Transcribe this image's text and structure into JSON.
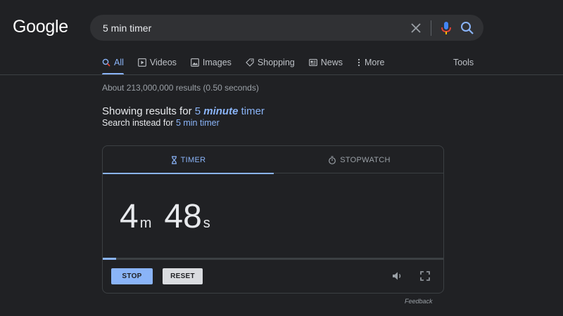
{
  "logo": "Google",
  "search": {
    "query": "5 min timer"
  },
  "tabs": [
    {
      "label": "All",
      "icon": "search-icon"
    },
    {
      "label": "Videos",
      "icon": "play-icon"
    },
    {
      "label": "Images",
      "icon": "image-icon"
    },
    {
      "label": "Shopping",
      "icon": "tag-icon"
    },
    {
      "label": "News",
      "icon": "news-icon"
    },
    {
      "label": "More",
      "icon": "dots-vertical-icon"
    }
  ],
  "tools_label": "Tools",
  "stats": "About 213,000,000 results (0.50 seconds)",
  "correction": {
    "prefix": "Showing results for",
    "num": "5",
    "bold": "minute",
    "rest": "timer",
    "instead_prefix": "Search instead for",
    "instead_link": "5 min timer"
  },
  "timer": {
    "tab_timer": "TIMER",
    "tab_stopwatch": "STOPWATCH",
    "minutes": "4",
    "minutes_unit": "m",
    "seconds": "48",
    "seconds_unit": "s",
    "progress_fraction": 0.04,
    "stop_label": "STOP",
    "reset_label": "RESET"
  },
  "feedback": "Feedback",
  "colors": {
    "accent": "#8ab4f8",
    "background": "#202124",
    "surface": "#303134"
  }
}
